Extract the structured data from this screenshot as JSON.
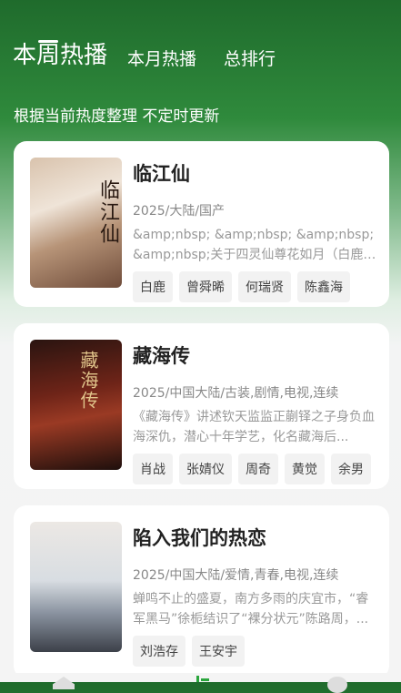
{
  "tabs": [
    {
      "label": "本周热播",
      "active": true
    },
    {
      "label": "本月热播",
      "active": false
    },
    {
      "label": "总排行",
      "active": false
    }
  ],
  "subtitle": "根据当前热度整理 不定时更新",
  "items": [
    {
      "title": "临江仙",
      "meta": "2025/大陆/国产",
      "desc": "&amp;nbsp; &amp;nbsp; &amp;nbsp; &amp;nbsp;关于四灵仙尊花如月（白鹿饰）...",
      "cast": [
        "白鹿",
        "曾舜晞",
        "何瑞贤",
        "陈鑫海"
      ],
      "poster_colors": [
        "#c9a98a",
        "#e8d8c8",
        "#7a5a48"
      ],
      "poster_text": "临江仙"
    },
    {
      "title": "藏海传",
      "meta": "2025/中国大陆/古装,剧情,电视,连续",
      "desc": "《藏海传》讲述钦天监监正蒯铎之子身负血海深仇，潜心十年学艺，化名藏海后...",
      "cast": [
        "肖战",
        "张婧仪",
        "周奇",
        "黄觉",
        "余男"
      ],
      "poster_colors": [
        "#3a1a14",
        "#8a2a1e",
        "#1a0e0c"
      ],
      "poster_text": "藏海传"
    },
    {
      "title": "陷入我们的热恋",
      "meta": "2025/中国大陆/爱情,青春,电视,连续",
      "desc": "蝉鸣不止的盛夏，南方多雨的庆宜市，“睿军黑马”徐栀结识了“裸分状元”陈路周，...",
      "cast": [
        "刘浩存",
        "王安宇"
      ],
      "poster_colors": [
        "#e8e2dc",
        "#b8c4cc",
        "#4a4e58"
      ],
      "poster_text": ""
    }
  ]
}
